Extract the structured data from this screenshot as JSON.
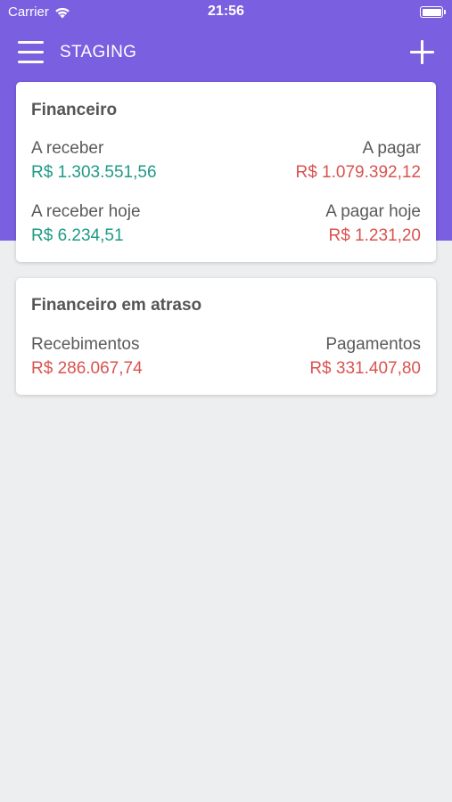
{
  "status_bar": {
    "carrier": "Carrier",
    "time": "21:56",
    "wifi_icon": "wifi-icon",
    "battery_icon": "battery-icon"
  },
  "app_bar": {
    "title": "STAGING",
    "menu_icon": "hamburger-menu-icon",
    "add_icon": "plus-icon",
    "color": "#7a5fe0"
  },
  "financeiro": {
    "title": "Financeiro",
    "receivable_label": "A receber",
    "receivable_value": "R$ 1.303.551,56",
    "payable_label": "A pagar",
    "payable_value": "R$ 1.079.392,12",
    "receivable_today_label": "A receber hoje",
    "receivable_today_value": "R$ 6.234,51",
    "payable_today_label": "A pagar hoje",
    "payable_today_value": "R$ 1.231,20"
  },
  "atraso": {
    "title": "Financeiro em atraso",
    "receipts_label": "Recebimentos",
    "receipts_value": "R$ 286.067,74",
    "payments_label": "Pagamentos",
    "payments_value": "R$ 331.407,80"
  },
  "colors": {
    "positive": "#1e9a86",
    "negative": "#d9534f",
    "background": "#eceef0"
  }
}
